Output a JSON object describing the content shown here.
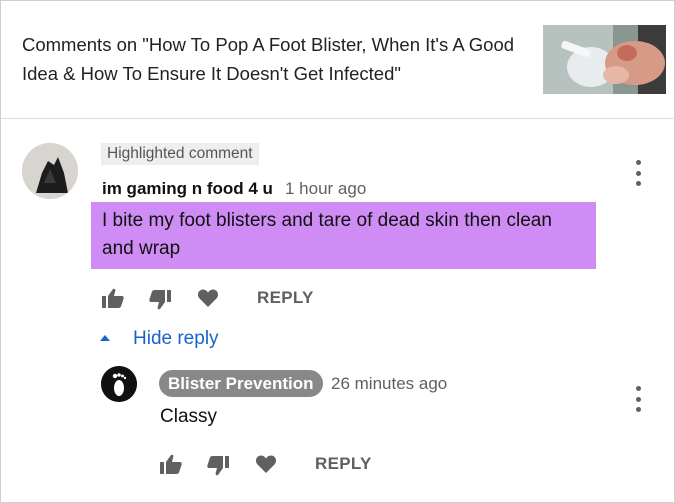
{
  "header": {
    "title": "Comments on \"How To Pop A Foot Blister, When It's A Good Idea & How To Ensure It Doesn't Get Infected\"",
    "thumbnail_icon": "video-thumbnail-foot-blister"
  },
  "comment": {
    "badge": "Highlighted comment",
    "author": "im gaming n food 4 u",
    "time": "1 hour ago",
    "text": "I bite my foot blisters and tare of dead skin then clean and wrap",
    "highlight_color": "#cf8cf4",
    "reply_label": "REPLY",
    "hide_reply_label": "Hide reply"
  },
  "reply": {
    "author": "Blister Prevention",
    "time": "26 minutes ago",
    "text": "Classy",
    "reply_label": "REPLY"
  },
  "colors": {
    "link_blue": "#1865c8",
    "icon_gray": "#606060",
    "author_badge_bg": "#888888"
  }
}
